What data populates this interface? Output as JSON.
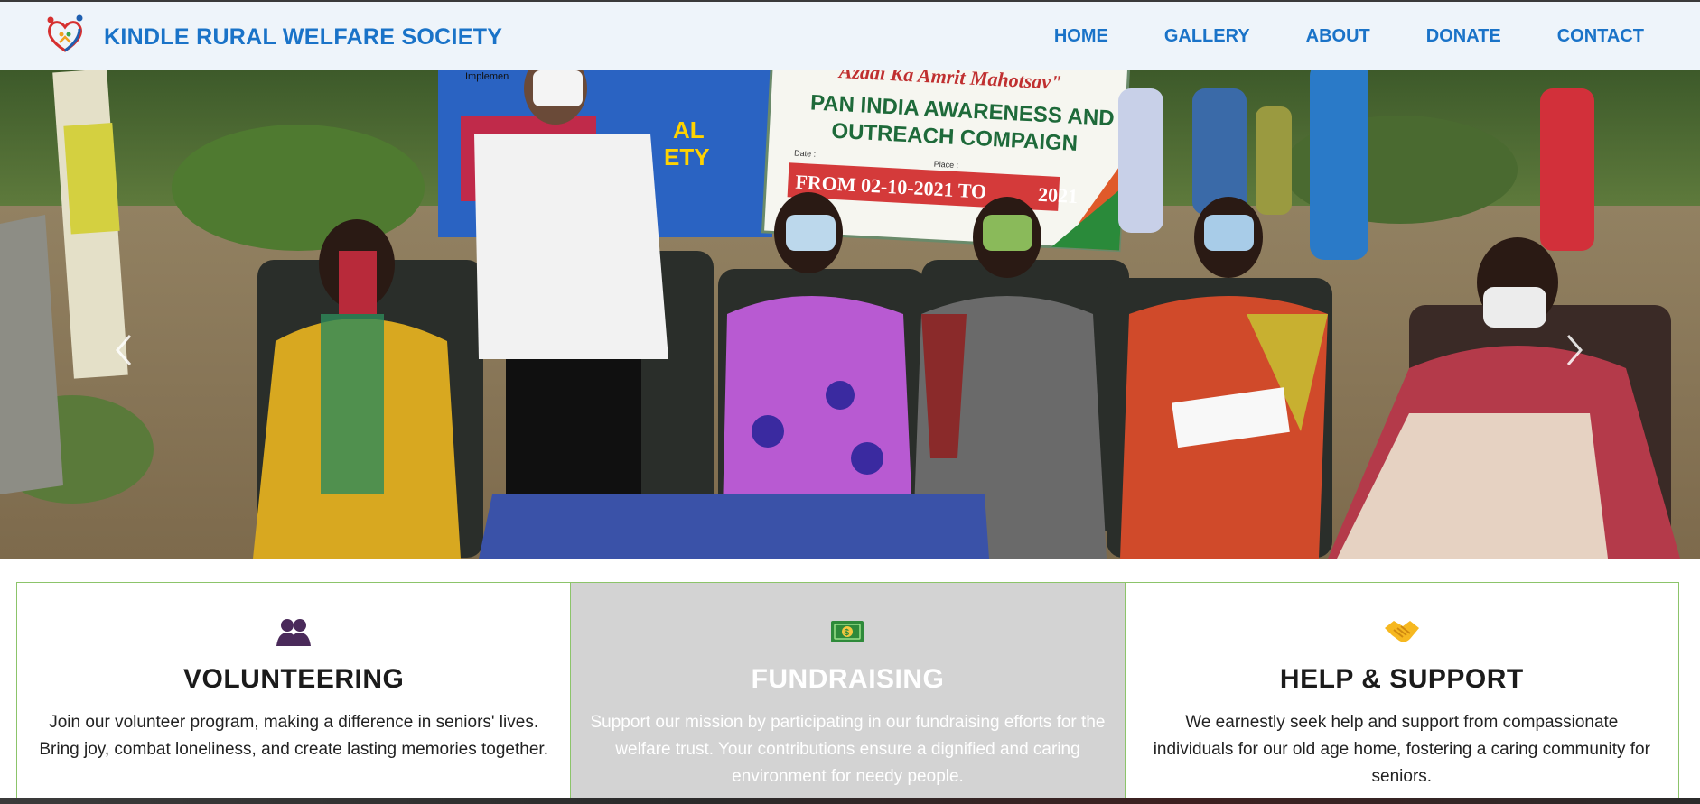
{
  "brand": {
    "name": "KINDLE RURAL WELFARE SOCIETY",
    "logo_icon": "heart-family-logo-icon"
  },
  "nav": {
    "items": [
      {
        "label": "HOME"
      },
      {
        "label": "GALLERY"
      },
      {
        "label": "ABOUT"
      },
      {
        "label": "DONATE"
      },
      {
        "label": "CONTACT"
      }
    ]
  },
  "hero": {
    "banner_main": {
      "line1": "Azadi Ka Amrit Mahotsav\"",
      "line2": "PAN INDIA AWARENESS AND",
      "line3": "OUTREACH COMPAIGN",
      "line4": "FROM 02-10-2021 TO",
      "line4b": "2021",
      "date_label": "Date :",
      "place_label": "Place :"
    },
    "banner_left": {
      "top": "Implemen",
      "line1": "AL",
      "line2": "ETY"
    },
    "prev_icon": "chevron-left-icon",
    "next_icon": "chevron-right-icon"
  },
  "cards": [
    {
      "icon": "people-icon",
      "title": "VOLUNTEERING",
      "text": "Join our volunteer program, making a difference in seniors' lives. Bring joy, combat loneliness, and create lasting memories together."
    },
    {
      "icon": "money-icon",
      "title": "FUNDRAISING",
      "text": "Support our mission by participating in our fundraising efforts for the welfare trust. Your contributions ensure a dignified and caring environment for needy people."
    },
    {
      "icon": "handshake-icon",
      "title": "HELP & SUPPORT",
      "text": "We earnestly seek help and support from compassionate individuals for our old age home, fostering a caring community for seniors."
    }
  ],
  "colors": {
    "brand": "#1a73c8",
    "card_border": "#8cc46a",
    "card_active_bg": "#d3d3d3"
  }
}
